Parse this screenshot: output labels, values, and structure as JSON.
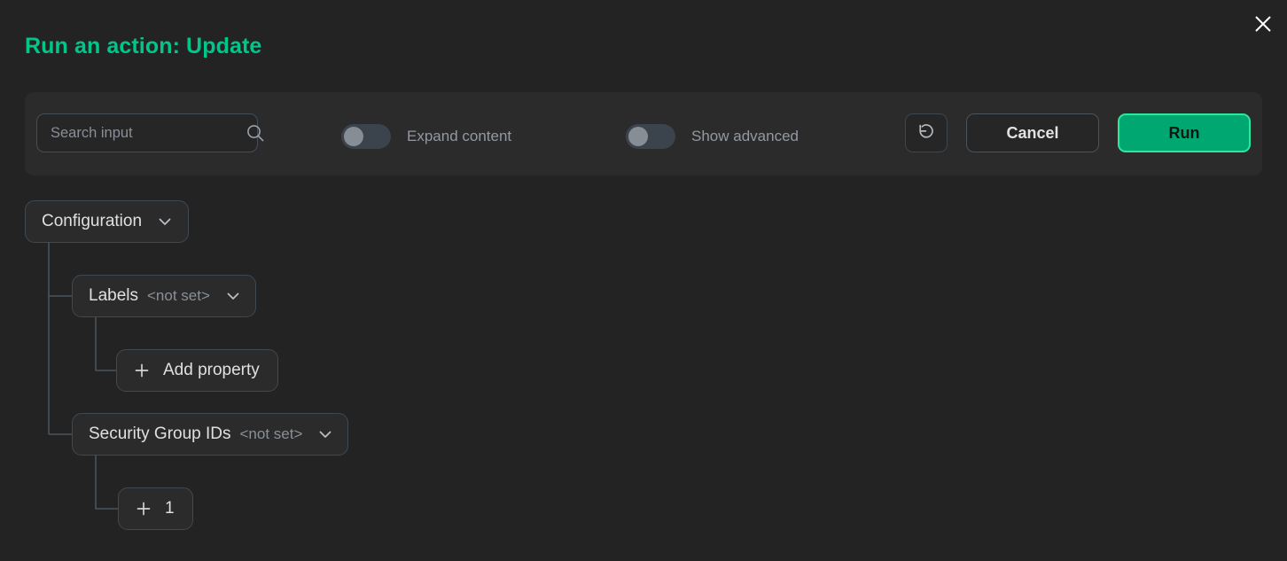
{
  "window": {
    "title": "Run an action: Update",
    "close_icon": "close-icon",
    "accent_color": "#00c68a",
    "background_color": "#232323",
    "panel_color": "#2b2b2b"
  },
  "toolbar": {
    "search": {
      "placeholder": "Search input",
      "value": "",
      "icon": "search-icon"
    },
    "toggles": [
      {
        "label": "Expand content",
        "checked": false
      },
      {
        "label": "Show advanced",
        "checked": false
      }
    ],
    "reset_button": {
      "icon": "reset-icon",
      "label": ""
    },
    "cancel_button": {
      "label": "Cancel"
    },
    "run_button": {
      "label": "Run",
      "color": "#00a771",
      "border_color": "#2ee79f"
    }
  },
  "tree": {
    "nodes": [
      {
        "id": "configuration",
        "label": "Configuration",
        "value": "",
        "chevron": "chevron-down-icon"
      },
      {
        "id": "labels",
        "label": "Labels",
        "value": "<not set>",
        "chevron": "chevron-down-icon"
      },
      {
        "id": "add-property",
        "label": "Add property",
        "icon": "plus-icon"
      },
      {
        "id": "security-group-ids",
        "label": "Security Group IDs",
        "value": "<not set>",
        "chevron": "chevron-down-icon"
      },
      {
        "id": "add-item",
        "label": "1",
        "icon": "plus-icon"
      }
    ]
  }
}
